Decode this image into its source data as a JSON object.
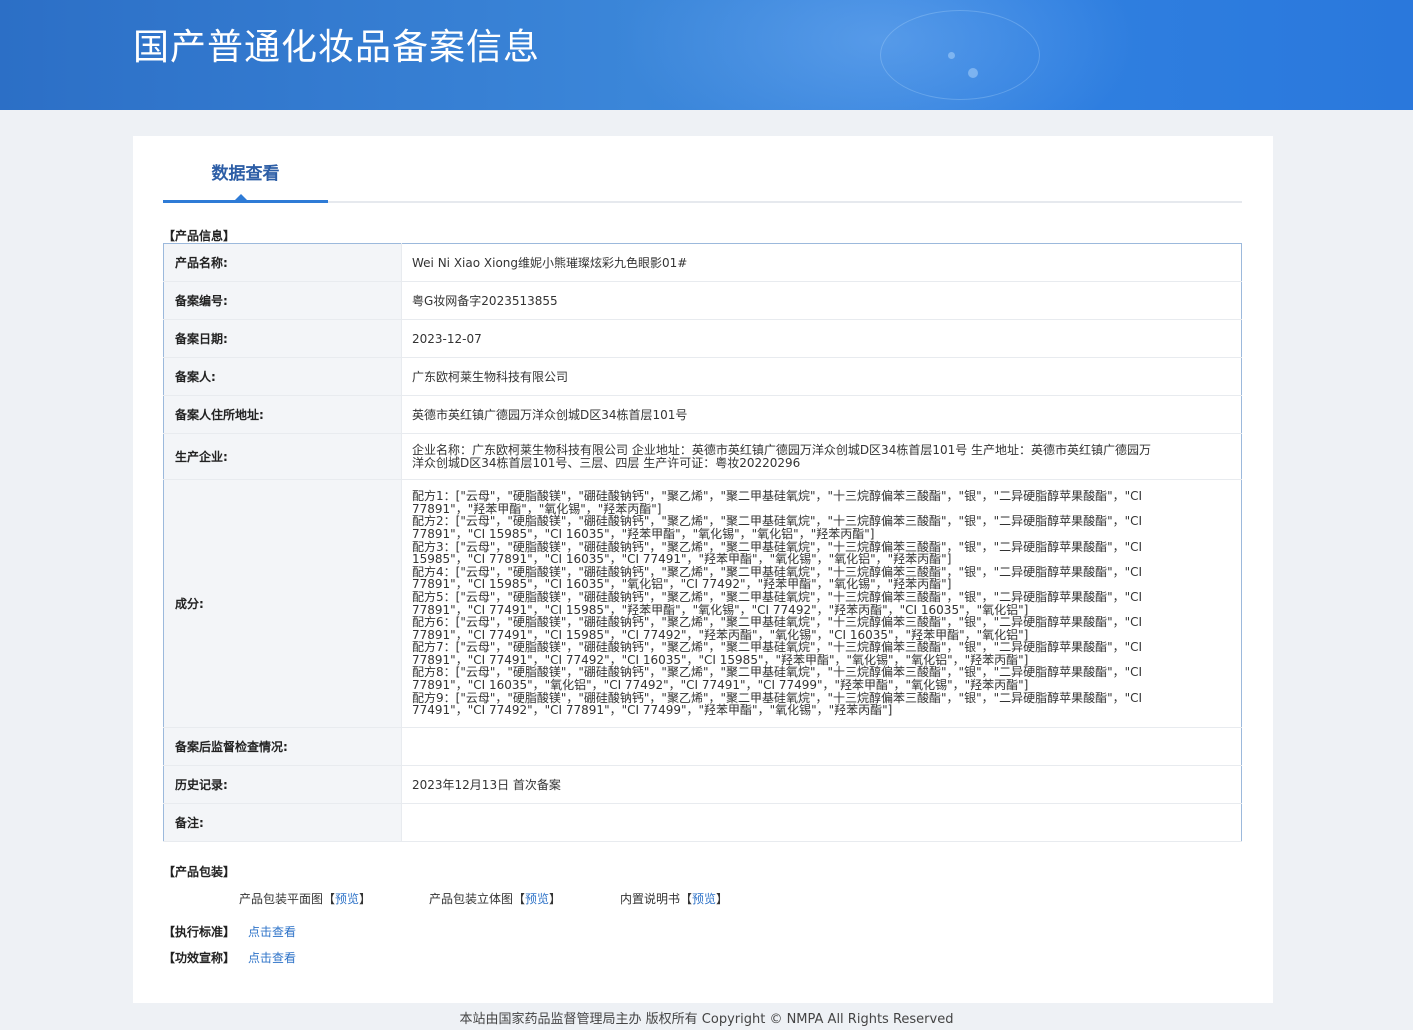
{
  "header": {
    "title": "国产普通化妆品备案信息"
  },
  "tabs": {
    "active_label": "数据查看"
  },
  "product_info": {
    "section_label": "【产品信息】",
    "rows": [
      {
        "key": "产品名称:",
        "value": "Wei Ni Xiao Xiong维妮小熊璀璨炫彩九色眼影01#"
      },
      {
        "key": "备案编号:",
        "value": "粤G妆网备字2023513855"
      },
      {
        "key": "备案日期:",
        "value": "2023-12-07"
      },
      {
        "key": "备案人:",
        "value": "广东欧柯莱生物科技有限公司"
      },
      {
        "key": "备案人住所地址:",
        "value": "英德市英红镇广德园万洋众创城D区34栋首层101号"
      },
      {
        "key": "生产企业:",
        "value_lines": [
          "企业名称：广东欧柯莱生物科技有限公司 企业地址：英德市英红镇广德园万洋众创城D区34栋首层101号 生产地址：英德市英红镇广德园万",
          "洋众创城D区34栋首层101号、三层、四层 生产许可证：粤妆20220296"
        ]
      },
      {
        "key": "成分:",
        "value_lines": [
          "配方1：[\"云母\"，\"硬脂酸镁\"，\"硼硅酸钠钙\"，\"聚乙烯\"，\"聚二甲基硅氧烷\"，\"十三烷醇偏苯三酸酯\"，\"银\"，\"二异硬脂醇苹果酸酯\"，\"CI",
          "77891\"，\"羟苯甲酯\"，\"氧化锡\"，\"羟苯丙酯\"]",
          "配方2：[\"云母\"，\"硬脂酸镁\"，\"硼硅酸钠钙\"，\"聚乙烯\"，\"聚二甲基硅氧烷\"，\"十三烷醇偏苯三酸酯\"，\"银\"，\"二异硬脂醇苹果酸酯\"，\"CI",
          "77891\"，\"CI 15985\"，\"CI 16035\"，\"羟苯甲酯\"，\"氧化锡\"，\"氧化铝\"，\"羟苯丙酯\"]",
          "配方3：[\"云母\"，\"硬脂酸镁\"，\"硼硅酸钠钙\"，\"聚乙烯\"，\"聚二甲基硅氧烷\"，\"十三烷醇偏苯三酸酯\"，\"银\"，\"二异硬脂醇苹果酸酯\"，\"CI",
          "15985\"，\"CI 77891\"，\"CI 16035\"，\"CI 77491\"，\"羟苯甲酯\"，\"氧化锡\"，\"氧化铝\"，\"羟苯丙酯\"]",
          "配方4：[\"云母\"，\"硬脂酸镁\"，\"硼硅酸钠钙\"，\"聚乙烯\"，\"聚二甲基硅氧烷\"，\"十三烷醇偏苯三酸酯\"，\"银\"，\"二异硬脂醇苹果酸酯\"，\"CI",
          "77891\"，\"CI 15985\"，\"CI 16035\"，\"氧化铝\"，\"CI 77492\"，\"羟苯甲酯\"，\"氧化锡\"，\"羟苯丙酯\"]",
          "配方5：[\"云母\"，\"硬脂酸镁\"，\"硼硅酸钠钙\"，\"聚乙烯\"，\"聚二甲基硅氧烷\"，\"十三烷醇偏苯三酸酯\"，\"银\"，\"二异硬脂醇苹果酸酯\"，\"CI",
          "77891\"，\"CI 77491\"，\"CI 15985\"，\"羟苯甲酯\"，\"氧化锡\"，\"CI 77492\"，\"羟苯丙酯\"，\"CI 16035\"，\"氧化铝\"]",
          "配方6：[\"云母\"，\"硬脂酸镁\"，\"硼硅酸钠钙\"，\"聚乙烯\"，\"聚二甲基硅氧烷\"，\"十三烷醇偏苯三酸酯\"，\"银\"，\"二异硬脂醇苹果酸酯\"，\"CI",
          "77891\"，\"CI 77491\"，\"CI 15985\"，\"CI 77492\"，\"羟苯丙酯\"，\"氧化锡\"，\"CI 16035\"，\"羟苯甲酯\"，\"氧化铝\"]",
          "配方7：[\"云母\"，\"硬脂酸镁\"，\"硼硅酸钠钙\"，\"聚乙烯\"，\"聚二甲基硅氧烷\"，\"十三烷醇偏苯三酸酯\"，\"银\"，\"二异硬脂醇苹果酸酯\"，\"CI",
          "77891\"，\"CI 77491\"，\"CI 77492\"，\"CI 16035\"，\"CI 15985\"，\"羟苯甲酯\"，\"氧化锡\"，\"氧化铝\"，\"羟苯丙酯\"]",
          "配方8：[\"云母\"，\"硬脂酸镁\"，\"硼硅酸钠钙\"，\"聚乙烯\"，\"聚二甲基硅氧烷\"，\"十三烷醇偏苯三酸酯\"，\"银\"，\"二异硬脂醇苹果酸酯\"，\"CI",
          "77891\"，\"CI 16035\"，\"氧化铝\"，\"CI 77492\"，\"CI 77491\"，\"CI 77499\"，\"羟苯甲酯\"，\"氧化锡\"，\"羟苯丙酯\"]",
          "配方9：[\"云母\"，\"硬脂酸镁\"，\"硼硅酸钠钙\"，\"聚乙烯\"，\"聚二甲基硅氧烷\"，\"十三烷醇偏苯三酸酯\"，\"银\"，\"二异硬脂醇苹果酸酯\"，\"CI",
          "77491\"，\"CI 77492\"，\"CI 77891\"，\"CI 77499\"，\"羟苯甲酯\"，\"氧化锡\"，\"羟苯丙酯\"]"
        ]
      },
      {
        "key": "备案后监督检查情况:",
        "value": ""
      },
      {
        "key": "历史记录:",
        "value": "2023年12月13日 首次备案"
      },
      {
        "key": "备注:",
        "value": ""
      }
    ]
  },
  "packaging": {
    "section_label": "【产品包装】",
    "items": [
      {
        "label": "产品包装平面图",
        "bracket_open": "【",
        "link": "预览",
        "bracket_close": "】"
      },
      {
        "label": "产品包装立体图",
        "bracket_open": "【",
        "link": "预览",
        "bracket_close": "】"
      },
      {
        "label": "内置说明书",
        "bracket_open": "【",
        "link": "预览",
        "bracket_close": "】"
      }
    ]
  },
  "standard": {
    "label": "【执行标准】",
    "link": "点击查看"
  },
  "efficacy": {
    "label": "【功效宣称】",
    "link": "点击查看"
  },
  "footer": {
    "text": "本站由国家药品监督管理局主办 版权所有 Copyright © NMPA All Rights Reserved"
  }
}
